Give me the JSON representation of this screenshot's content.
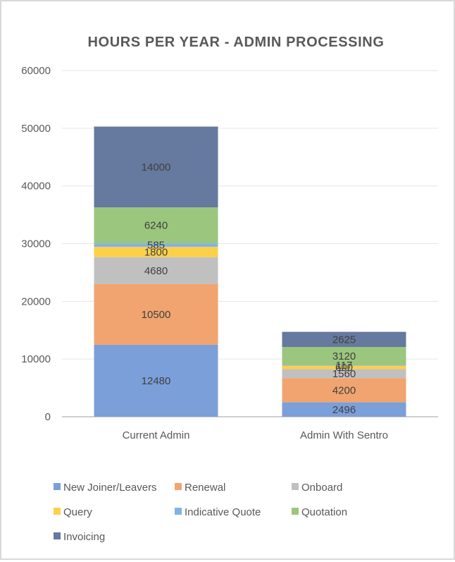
{
  "chart_data": {
    "type": "bar",
    "stacked": true,
    "title": "HOURS PER YEAR - ADMIN PROCESSING",
    "xlabel": "",
    "ylabel": "",
    "ylim": [
      0,
      60000
    ],
    "yticks": [
      0,
      10000,
      20000,
      30000,
      40000,
      50000,
      60000
    ],
    "ytick_labels": [
      "0",
      "10000",
      "20000",
      "30000",
      "40000",
      "50000",
      "60000"
    ],
    "grid": true,
    "legend_position": "bottom",
    "categories": [
      "Current Admin",
      "Admin With Sentro"
    ],
    "series": [
      {
        "name": "New Joiner/Leavers",
        "color": "#7b9fd9",
        "values": [
          12480,
          2496
        ]
      },
      {
        "name": "Renewal",
        "color": "#f1a46f",
        "values": [
          10500,
          4200
        ]
      },
      {
        "name": "Onboard",
        "color": "#c0c0c0",
        "values": [
          4680,
          1560
        ]
      },
      {
        "name": "Query",
        "color": "#fdd04a",
        "values": [
          1800,
          600
        ]
      },
      {
        "name": "Indicative Quote",
        "color": "#82b2e4",
        "values": [
          585,
          117
        ]
      },
      {
        "name": "Quotation",
        "color": "#9bc67e",
        "values": [
          6240,
          3120
        ]
      },
      {
        "name": "Invoicing",
        "color": "#66799e",
        "values": [
          14000,
          2625
        ]
      }
    ]
  }
}
